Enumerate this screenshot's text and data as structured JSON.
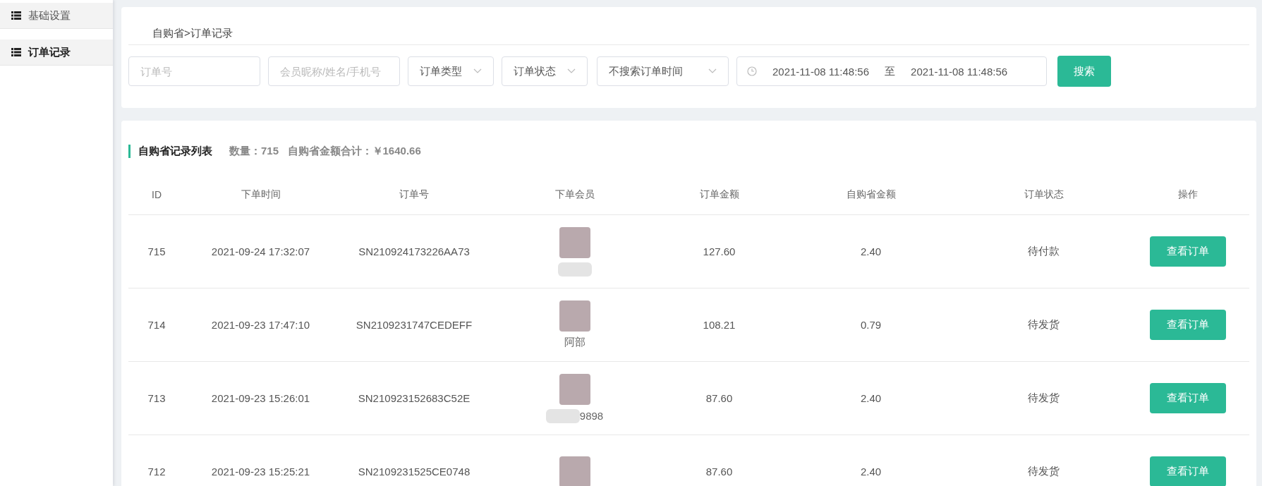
{
  "sidebar": {
    "items": [
      {
        "label": "基础设置",
        "selected": false
      },
      {
        "label": "订单记录",
        "selected": true
      }
    ]
  },
  "breadcrumb": "自购省>订单记录",
  "filters": {
    "order_no": {
      "placeholder": "订单号"
    },
    "member": {
      "placeholder": "会员昵称/姓名/手机号"
    },
    "order_type": "订单类型",
    "order_status": "订单状态",
    "time_mode": "不搜索订单时间",
    "date_start": "2021-11-08 11:48:56",
    "date_sep": "至",
    "date_end": "2021-11-08 11:48:56",
    "search_button": "搜索"
  },
  "list": {
    "title": "自购省记录列表",
    "summary": "数量：715   自购省金额合计：￥1640.66"
  },
  "table": {
    "columns": [
      "ID",
      "下单时间",
      "订单号",
      "下单会员",
      "订单金额",
      "自购省金额",
      "订单状态",
      "操作"
    ],
    "rows": [
      {
        "id": "715",
        "time": "2021-09-24 17:32:07",
        "order_no": "SN210924173226AA73",
        "member_blurred": true,
        "amount": "127.60",
        "saving": "2.40",
        "status": "待付款",
        "action": "查看订单"
      },
      {
        "id": "714",
        "time": "2021-09-23 17:47:10",
        "order_no": "SN2109231747CEDEFF",
        "member": "阿部",
        "member_blurred": false,
        "amount": "108.21",
        "saving": "0.79",
        "status": "待发货",
        "action": "查看订单"
      },
      {
        "id": "713",
        "time": "2021-09-23 15:26:01",
        "order_no": "SN210923152683C52E",
        "member": "9898",
        "member_blurred": true,
        "amount": "87.60",
        "saving": "2.40",
        "status": "待发货",
        "action": "查看订单"
      },
      {
        "id": "712",
        "time": "2021-09-23 15:25:21",
        "order_no": "SN2109231525CE0748",
        "member_blurred": false,
        "amount": "87.60",
        "saving": "2.40",
        "status": "待发货",
        "action": "查看订单"
      }
    ]
  }
}
